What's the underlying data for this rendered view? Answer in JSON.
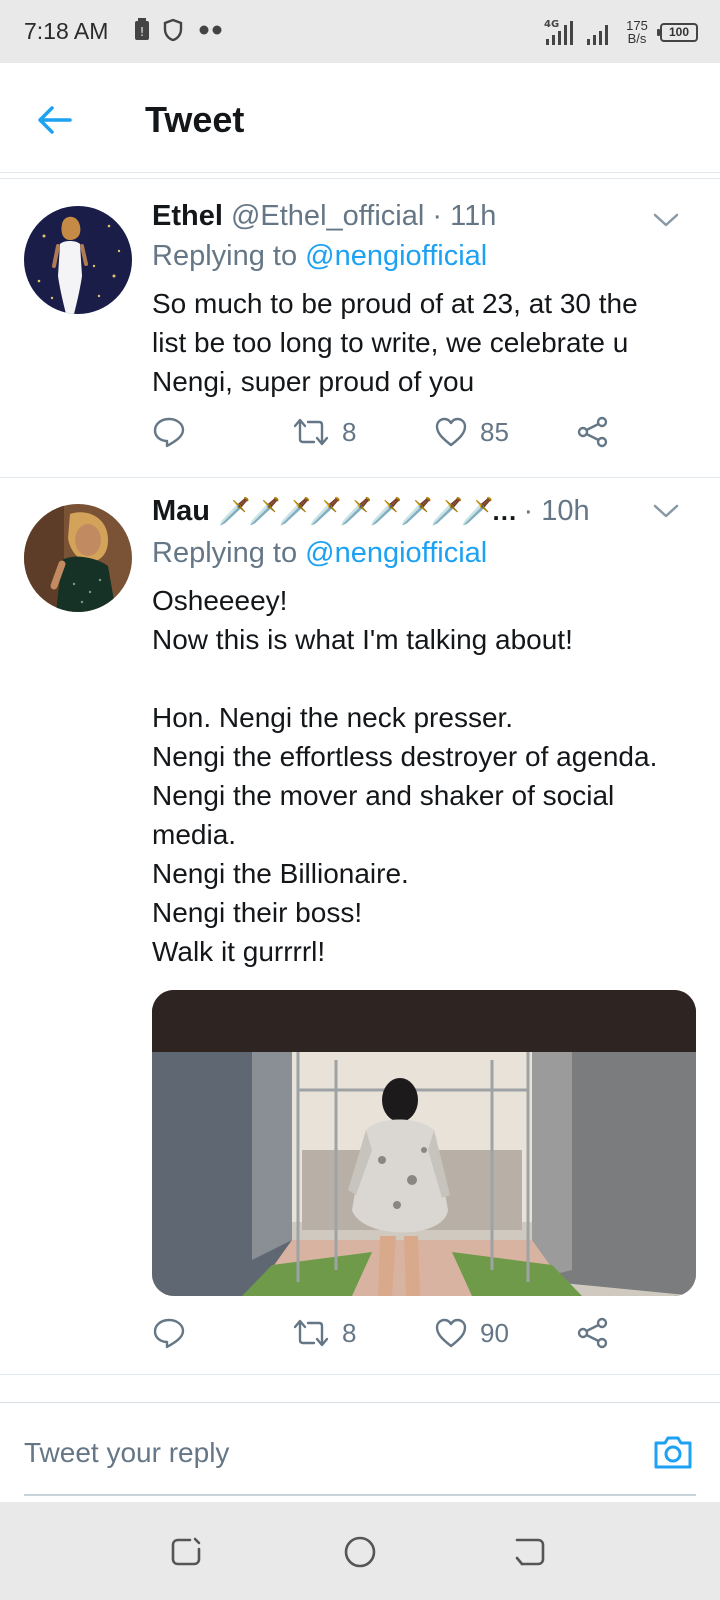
{
  "status_bar": {
    "time": "7:18 AM",
    "network": "4G",
    "net_speed_value": "175",
    "net_speed_unit": "B/s",
    "battery": "100"
  },
  "header": {
    "title": "Tweet",
    "back_icon": "arrow-left-icon"
  },
  "tweets": [
    {
      "name": "Ethel",
      "handle": "@Ethel_official",
      "time": "· 11h",
      "replying_prefix": "Replying to ",
      "replying_to": "@nengiofficial",
      "text": "So much to be proud of at 23, at 30 the\nlist  be too long to write, we celebrate u\nNengi, super proud of you",
      "retweets": "8",
      "likes": "85"
    },
    {
      "name": "Mau",
      "name_suffix": "🗡️🗡️🗡️🗡️🗡️🗡️🗡️🗡️🗡️…",
      "time": "· 10h",
      "replying_prefix": "Replying to ",
      "replying_to": "@nengiofficial",
      "text": "Osheeeey!\nNow this is what I'm talking about!\n\nHon. Nengi the neck presser.\nNengi the effortless destroyer of agenda.\nNengi the mover and shaker of social\nmedia.\nNengi the Billionaire.\nNengi their boss!\nWalk it gurrrrl!",
      "retweets": "8",
      "likes": "90"
    }
  ],
  "reply": {
    "placeholder": "Tweet your reply",
    "camera_icon": "camera-icon"
  },
  "colors": {
    "accent": "#1da1f2",
    "secondary_text": "#657786",
    "divider": "#e1e8ed"
  }
}
